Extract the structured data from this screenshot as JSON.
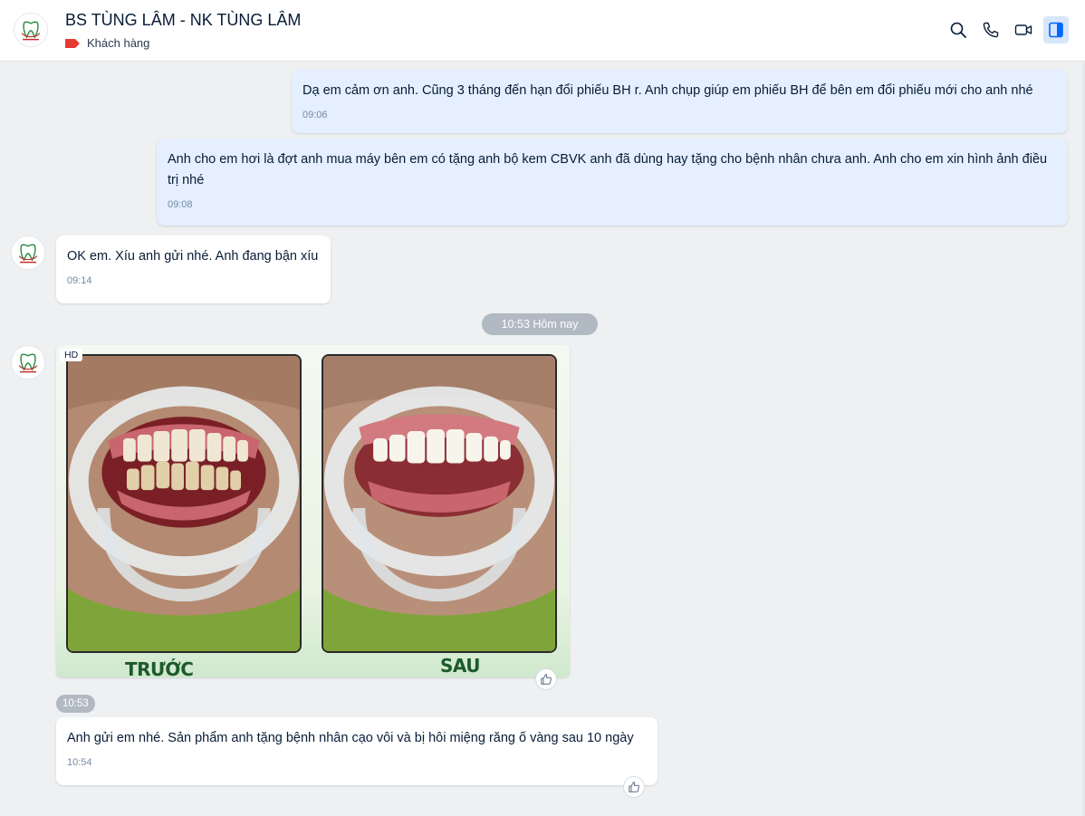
{
  "header": {
    "title": "BS TÙNG LÂM - NK TÙNG LÂM",
    "tag_label": "Khách hàng",
    "tag_color": "#e53935",
    "actions": [
      {
        "icon": "search-icon"
      },
      {
        "icon": "phone-icon"
      },
      {
        "icon": "video-call-icon"
      },
      {
        "icon": "sidebar-toggle-icon",
        "active": true
      }
    ]
  },
  "messages": [
    {
      "direction": "out",
      "text": "Dạ em cảm ơn anh. Cũng 3 tháng đến hạn đổi phiếu BH r. Anh chụp giúp em phiếu BH để bên em đổi phiếu mới cho anh nhé",
      "time": "09:06"
    },
    {
      "direction": "out",
      "text": "Anh cho em hơi là đợt anh mua máy bên em có tặng anh bộ kem CBVK anh đã dùng hay tặng cho bệnh nhân chưa anh. Anh cho em xin hình ảnh điều trị nhé",
      "time": "09:08"
    },
    {
      "direction": "in",
      "text": "OK em. Xíu anh gửi nhé. Anh đang bận xíu",
      "time": "09:14"
    }
  ],
  "divider": "10:53 Hôm nay",
  "photo_message": {
    "hd_badge": "HD",
    "label_before": "TRƯỚC",
    "label_after": "SAU",
    "time": "10:53"
  },
  "last_message": {
    "direction": "in",
    "text": "Anh gửi em nhé. Sản phẩm anh tặng bệnh nhân cạo vôi và bị hôi miệng răng ố vàng sau 10 ngày",
    "time": "10:54"
  },
  "colors": {
    "outgoing_bubble": "#e5efff",
    "incoming_bubble": "#ffffff",
    "chat_background": "#eef0f1",
    "accent": "#0068ff"
  }
}
